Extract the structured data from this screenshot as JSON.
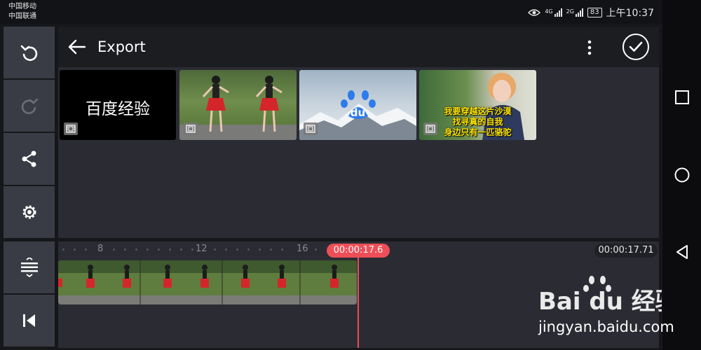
{
  "status_bar": {
    "carrier1": "中国移动",
    "carrier2": "中国联通",
    "net1": "4G",
    "net2": "2G",
    "battery": "83",
    "time": "上午10:37"
  },
  "header": {
    "title": "Export"
  },
  "media": [
    {
      "type": "title-card",
      "text": "百度经验"
    },
    {
      "type": "video",
      "text": ""
    },
    {
      "type": "image",
      "text": "du"
    },
    {
      "type": "video",
      "text": "我要穿越这片沙漠\n找寻真的自我\n身边只有一匹骆驼"
    }
  ],
  "timeline": {
    "ruler_labels": [
      "8",
      "12",
      "16"
    ],
    "playhead_time": "00:00:17.6",
    "total_time": "00:00:17.71"
  },
  "watermark": {
    "logo_text": "Bai du 经验",
    "url": "jingyan.baidu.com"
  },
  "colors": {
    "accent": "#ee4e57",
    "panel": "#2b2c33",
    "toolbar_button": "#3a3c45"
  }
}
